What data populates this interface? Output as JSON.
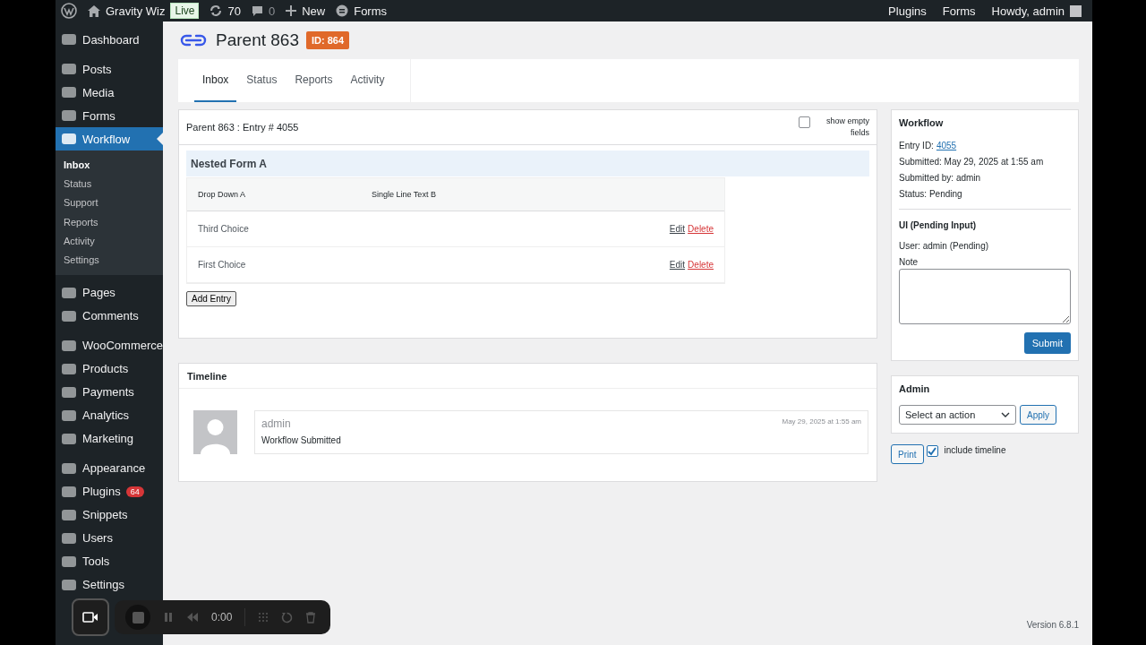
{
  "admin_bar": {
    "site": "Gravity Wiz",
    "live": "Live",
    "updates": "70",
    "comments": "0",
    "new": "New",
    "forms": "Forms",
    "right": [
      "Plugins",
      "Forms"
    ],
    "howdy": "Howdy, admin"
  },
  "sidebar": {
    "groups": [
      [
        {
          "label": "Dashboard",
          "selected": false
        }
      ],
      [
        {
          "label": "Posts",
          "selected": false
        },
        {
          "label": "Media",
          "selected": false
        },
        {
          "label": "Forms",
          "selected": false
        },
        {
          "label": "Workflow",
          "selected": true,
          "children": [
            {
              "label": "Inbox",
              "selected": true
            },
            {
              "label": "Status",
              "selected": false
            },
            {
              "label": "Support",
              "selected": false
            },
            {
              "label": "Reports",
              "selected": false
            },
            {
              "label": "Activity",
              "selected": false
            },
            {
              "label": "Settings",
              "selected": false
            }
          ]
        }
      ],
      [
        {
          "label": "Pages",
          "selected": false
        },
        {
          "label": "Comments",
          "selected": false
        }
      ],
      [
        {
          "label": "WooCommerce",
          "selected": false
        },
        {
          "label": "Products",
          "selected": false
        },
        {
          "label": "Payments",
          "selected": false
        },
        {
          "label": "Analytics",
          "selected": false
        },
        {
          "label": "Marketing",
          "selected": false
        }
      ],
      [
        {
          "label": "Appearance",
          "selected": false
        },
        {
          "label": "Plugins",
          "selected": false,
          "badge": "64"
        },
        {
          "label": "Snippets",
          "selected": false
        },
        {
          "label": "Users",
          "selected": false
        },
        {
          "label": "Tools",
          "selected": false
        },
        {
          "label": "Settings",
          "selected": false
        }
      ]
    ]
  },
  "page": {
    "title": "Parent 863",
    "id_badge": "ID: 864",
    "tabs": [
      {
        "label": "Inbox",
        "selected": true
      },
      {
        "label": "Status",
        "selected": false
      },
      {
        "label": "Reports",
        "selected": false
      },
      {
        "label": "Activity",
        "selected": false
      }
    ]
  },
  "entry": {
    "heading": "Parent 863 : Entry # 4055",
    "show_empty": {
      "label": "show empty fields",
      "checked": false
    },
    "nested_form": {
      "title": "Nested Form A",
      "columns": [
        "Drop Down A",
        "Single Line Text B"
      ],
      "rows": [
        {
          "cells": [
            "Third Choice"
          ],
          "actions": [
            "Edit",
            "Delete"
          ]
        },
        {
          "cells": [
            "First Choice"
          ],
          "actions": [
            "Edit",
            "Delete"
          ]
        }
      ],
      "add_button": "Add Entry"
    }
  },
  "timeline": {
    "title": "Timeline",
    "items": [
      {
        "user": "admin",
        "date": "May 29, 2025 at 1:55 am",
        "text": "Workflow Submitted"
      }
    ]
  },
  "workflow": {
    "title": "Workflow",
    "entry_id_label": "Entry ID:",
    "entry_id": "4055",
    "lines": [
      "Submitted: May 29, 2025 at 1:55 am",
      "Submitted by: admin",
      "Status: Pending"
    ],
    "step": "UI (Pending Input)",
    "user": "User: admin (Pending)",
    "note_label": "Note",
    "submit": "Submit"
  },
  "admin": {
    "title": "Admin",
    "select": "Select an action",
    "apply": "Apply"
  },
  "print": {
    "button": "Print",
    "include_timeline": {
      "label": "include timeline",
      "checked": true
    }
  },
  "footer": {
    "version": "Version 6.8.1"
  },
  "recorder": {
    "time": "0:00"
  }
}
